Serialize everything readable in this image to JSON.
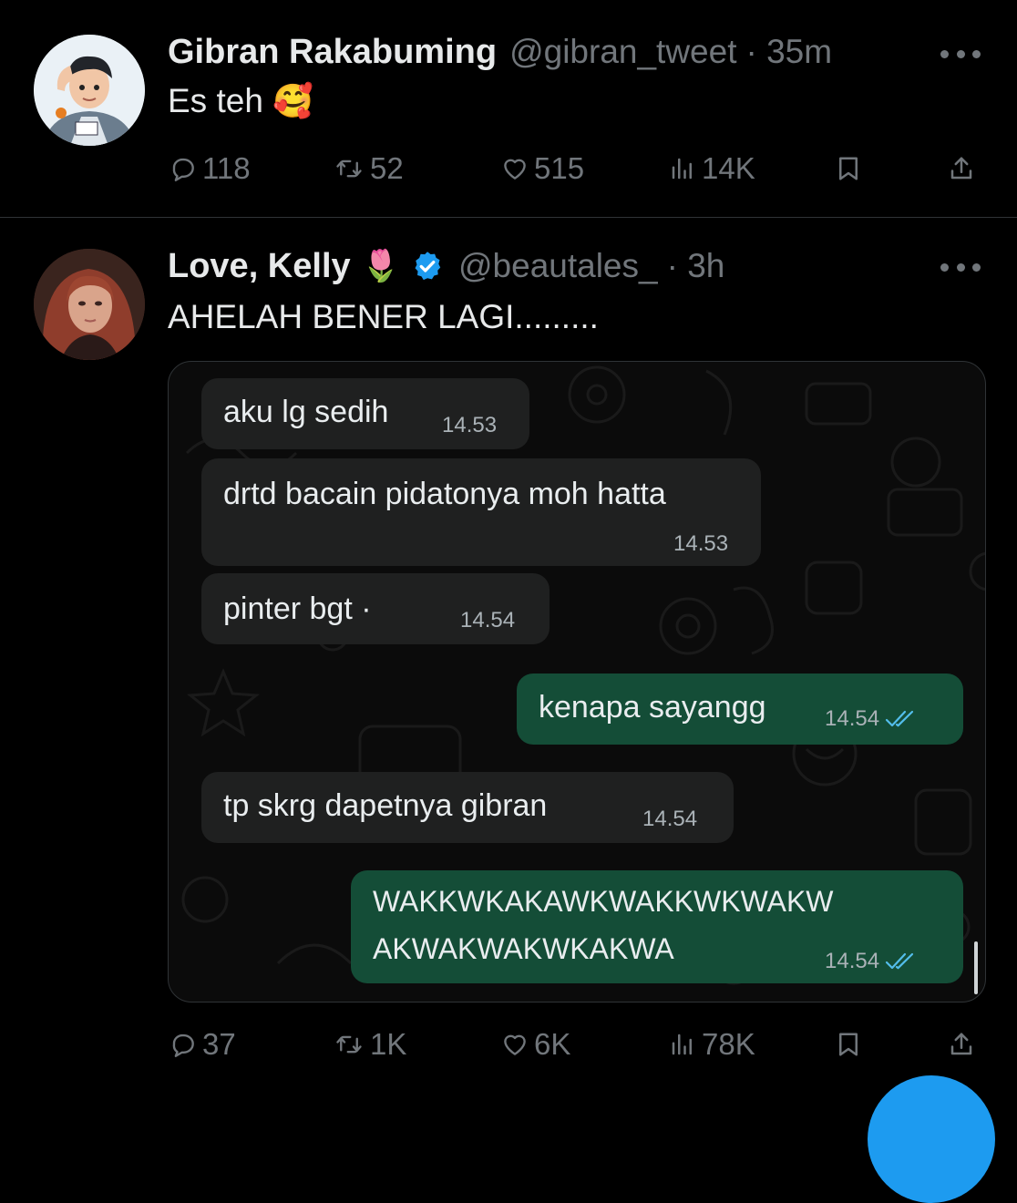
{
  "tweets": [
    {
      "name": "Gibran Rakabuming",
      "handle": "@gibran_tweet",
      "time": "· 35m",
      "text": "Es teh",
      "emoji": "🥰",
      "stats": {
        "replies": "118",
        "retweets": "52",
        "likes": "515",
        "views": "14K"
      }
    },
    {
      "name": "Love, Kelly",
      "name_emoji": "🌷",
      "handle": "@beautales_",
      "time": "· 3h",
      "text": "AHELAH BENER LAGI.........",
      "stats": {
        "replies": "37",
        "retweets": "1K",
        "likes": "6K",
        "views": "78K"
      }
    }
  ],
  "chat": {
    "messages": [
      {
        "dir": "in",
        "text": "aku lg sedih",
        "time": "14.53"
      },
      {
        "dir": "in",
        "text": "drtd bacain pidatonya moh hatta",
        "time": "14.53"
      },
      {
        "dir": "in",
        "text": "pinter bgt ·",
        "time": "14.54"
      },
      {
        "dir": "out",
        "text": "kenapa sayangg",
        "time": "14.54"
      },
      {
        "dir": "in",
        "text": "tp skrg dapetnya gibran",
        "time": "14.54"
      },
      {
        "dir": "out",
        "text": "WAKKWKAKAWKWAKKWKWAKW",
        "text2": "AKWAKWAKWKAKWA",
        "time": "14.54"
      }
    ]
  },
  "icons": {
    "reply": "reply-icon",
    "retweet": "retweet-icon",
    "like": "heart-icon",
    "views": "views-icon",
    "bookmark": "bookmark-icon",
    "share": "share-icon",
    "more": "more-icon",
    "verified": "verified-badge-icon"
  },
  "colors": {
    "background": "#000000",
    "text": "#e7e9ea",
    "muted": "#71767b",
    "verified": "#1d9bf0",
    "incoming_bubble": "#1f2020",
    "outgoing_bubble": "#144d37",
    "read_ticks": "#53bdeb"
  }
}
